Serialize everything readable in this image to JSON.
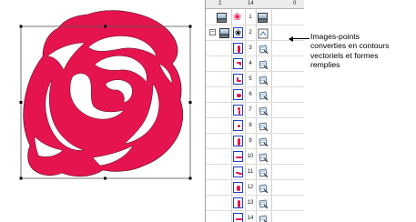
{
  "panel": {
    "header": [
      "2",
      "14",
      "0"
    ],
    "group_row": {
      "number": "1"
    },
    "rows": [
      {
        "number": "2",
        "shape": "curl",
        "stitch": "picture"
      },
      {
        "number": "3",
        "shape": "petal",
        "stitch": "vector"
      },
      {
        "number": "4",
        "shape": "hook",
        "stitch": "vector"
      },
      {
        "number": "5",
        "shape": "leaf",
        "stitch": "vector"
      },
      {
        "number": "6",
        "shape": "blob",
        "stitch": "vector"
      },
      {
        "number": "7",
        "shape": "arc",
        "stitch": "vector"
      },
      {
        "number": "8",
        "shape": "dot",
        "stitch": "vector"
      },
      {
        "number": "9",
        "shape": "petal",
        "stitch": "vector"
      },
      {
        "number": "10",
        "shape": "stroke",
        "stitch": "vector"
      },
      {
        "number": "11",
        "shape": "wave",
        "stitch": "vector"
      },
      {
        "number": "12",
        "shape": "tilt",
        "stitch": "vector"
      },
      {
        "number": "13",
        "shape": "tall",
        "stitch": "vector"
      },
      {
        "number": "14",
        "shape": "stroke",
        "stitch": "vector"
      }
    ]
  },
  "callout": {
    "text": "Images-points\nconverties en contours\nvectoriels et formes\nremplies"
  },
  "colors": {
    "rose": "#e6144e",
    "selection_border": "#1f3fc6"
  }
}
